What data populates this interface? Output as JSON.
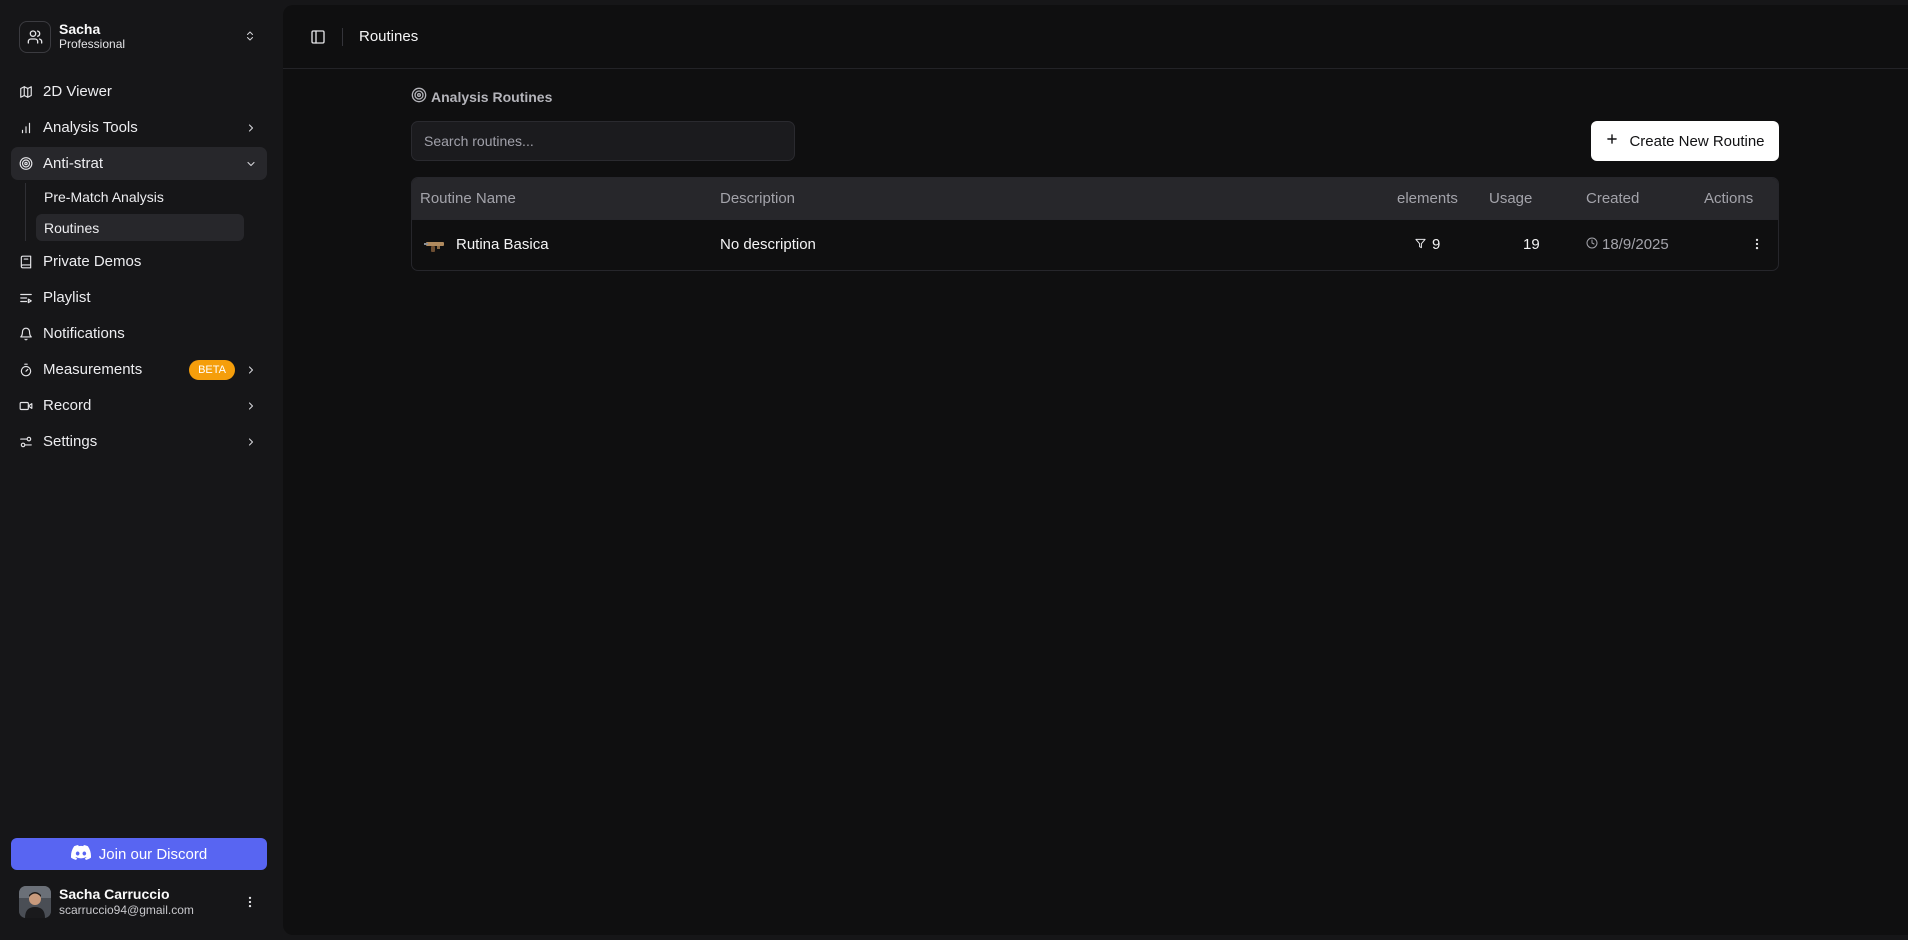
{
  "team": {
    "name": "Sacha",
    "plan": "Professional"
  },
  "nav": {
    "viewer": "2D Viewer",
    "analysis_tools": "Analysis Tools",
    "anti_strat": "Anti-strat",
    "anti_strat_sub": [
      "Pre-Match Analysis",
      "Routines"
    ],
    "private_demos": "Private Demos",
    "playlist": "Playlist",
    "notifications": "Notifications",
    "measurements": "Measurements",
    "measurements_badge": "BETA",
    "record": "Record",
    "settings": "Settings"
  },
  "discord": {
    "label": "Join our Discord",
    "color": "#5865f2"
  },
  "user": {
    "name": "Sacha Carruccio",
    "email": "scarruccio94@gmail.com"
  },
  "header": {
    "breadcrumb": "Routines"
  },
  "page": {
    "section_title": "Analysis Routines",
    "search_placeholder": "Search routines...",
    "create_label": "Create New Routine"
  },
  "table": {
    "columns": [
      "Routine Name",
      "Description",
      "elements",
      "Usage",
      "Created",
      "Actions"
    ],
    "rows": [
      {
        "name": "Rutina Basica",
        "description": "No description",
        "elements": "9",
        "usage": "19",
        "created": "18/9/2025"
      }
    ]
  },
  "colors": {
    "accent_badge": "#f59e0b",
    "background": "#0f0f10",
    "sidebar": "#161618"
  }
}
